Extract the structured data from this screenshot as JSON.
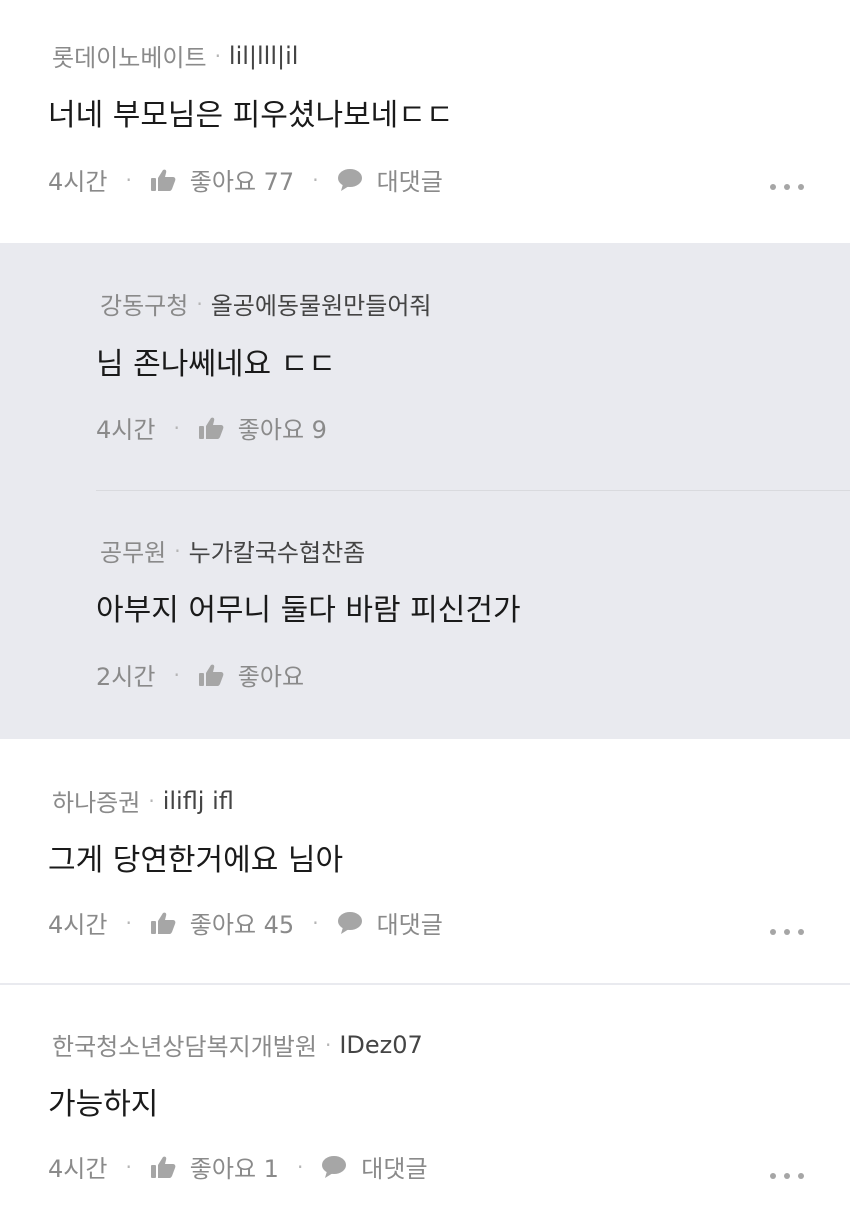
{
  "comments": [
    {
      "author": "롯데이노베이트",
      "nickname": "lil|lll|il",
      "text": "너네 부모님은 피우셨나보네ㄷㄷ",
      "time": "4시간",
      "like_label": "좋아요 77",
      "reply_label": "대댓글"
    },
    {
      "author": "하나증권",
      "nickname": "iliflj ifl",
      "text": "그게 당연한거에요 님아",
      "time": "4시간",
      "like_label": "좋아요 45",
      "reply_label": "대댓글"
    },
    {
      "author": "한국청소년상담복지개발원",
      "nickname": "IDez07",
      "text": "가능하지",
      "time": "4시간",
      "like_label": "좋아요 1",
      "reply_label": "대댓글"
    }
  ],
  "replies": [
    {
      "author": "강동구청",
      "nickname": "올공에동물원만들어줘",
      "text": "님 존나쎄네요 ㄷㄷ",
      "time": "4시간",
      "like_label": "좋아요 9"
    },
    {
      "author": "공무원",
      "nickname": "누가칼국수협찬좀",
      "text": "아부지 어무니 둘다 바람 피신건가",
      "time": "2시간",
      "like_label": "좋아요"
    }
  ],
  "icons": {
    "like": "thumbs-up-icon",
    "reply": "speech-bubble-icon",
    "more": "more-dots-icon"
  }
}
